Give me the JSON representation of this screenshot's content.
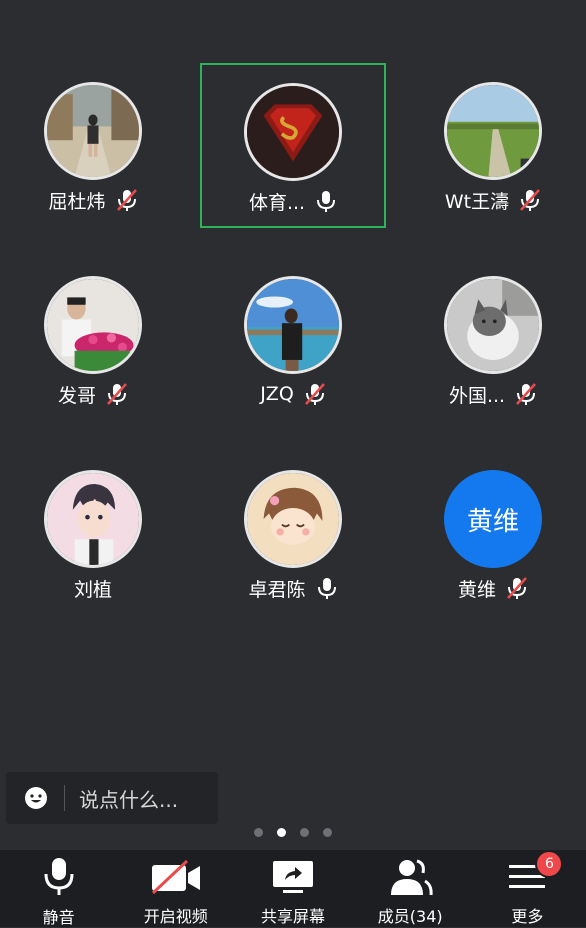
{
  "participants": [
    {
      "name": "屈杜炜",
      "mic": "muted"
    },
    {
      "name": "体育...",
      "mic": "on",
      "active": true
    },
    {
      "name": "Wt王濤",
      "mic": "muted"
    },
    {
      "name": "发哥",
      "mic": "muted"
    },
    {
      "name": "JZQ",
      "mic": "muted"
    },
    {
      "name": "外国...",
      "mic": "muted"
    },
    {
      "name": "刘植",
      "mic": "none"
    },
    {
      "name": "卓君陈",
      "mic": "on"
    },
    {
      "name": "黄维",
      "mic": "muted",
      "avatar_text": "黄维"
    }
  ],
  "chat": {
    "placeholder": "说点什么..."
  },
  "pager": {
    "pages": 4,
    "current": 2
  },
  "toolbar": {
    "mute_label": "静音",
    "video_label": "开启视频",
    "share_label": "共享屏幕",
    "members_label": "成员(34)",
    "more_label": "更多",
    "more_badge": "6"
  },
  "colors": {
    "active_border": "#2fb35a",
    "muted_slash": "#e84b4b",
    "accent_avatar": "#1479ee",
    "badge": "#f0474a"
  }
}
